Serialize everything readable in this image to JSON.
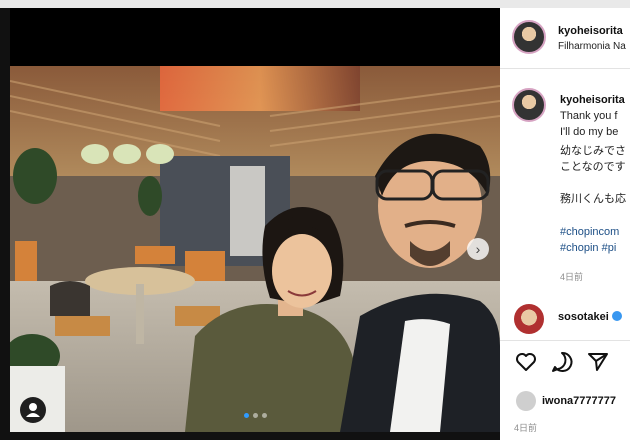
{
  "header": {
    "username": "kyoheisorita",
    "location": "Filharmonia Na"
  },
  "caption": {
    "username": "kyoheisorita",
    "lines": [
      "Thank you f",
      "I'll do my be",
      "幼なじみでさ",
      "ことなのです",
      "",
      "務川くんも応",
      "",
      "#chopincom",
      "#chopin #pi"
    ],
    "time": "4日前"
  },
  "comment": {
    "username": "sosotakei"
  },
  "actions": {
    "like_icon": "heart-icon",
    "comment_icon": "comment-icon",
    "share_icon": "send-icon"
  },
  "liked_by": {
    "username": "iwona7777777"
  },
  "footer": {
    "time": "4日前"
  },
  "colors": {
    "hashtag": "#1d4f86",
    "avatar_ring": "#d6a3c2",
    "dot_active": "#2f9bff",
    "verified": "#3897f0"
  }
}
